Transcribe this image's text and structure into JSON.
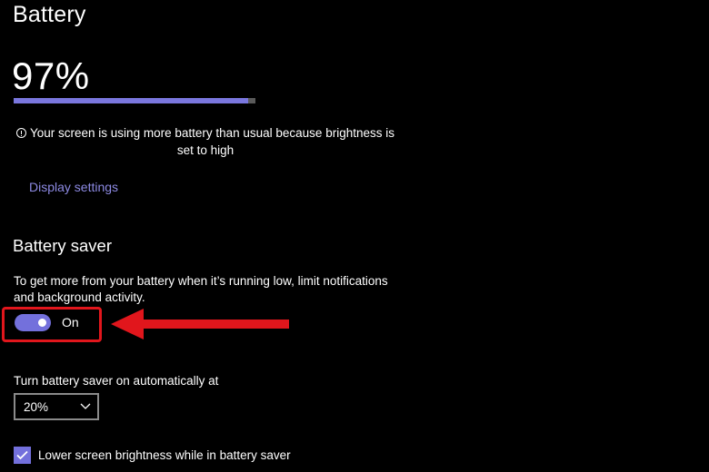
{
  "page": {
    "title": "Battery"
  },
  "battery": {
    "percent_text": "97%",
    "level": 0.97,
    "fill_color": "#7a77de",
    "warning_line1": "Your screen is using more battery than usual because brightness is",
    "warning_line2": "set to high",
    "warning_icon": "info-icon",
    "display_settings_link": "Display settings"
  },
  "battery_saver": {
    "heading": "Battery saver",
    "description_line1": "To get more from your battery when it’s running low, limit notifications",
    "description_line2": "and background activity.",
    "toggle_state": "On",
    "toggle_color": "#7370dc",
    "highlight_color": "#e1161c",
    "auto_label": "Turn battery saver on automatically at",
    "auto_value": "20%",
    "lower_brightness_label": "Lower screen brightness while in battery saver",
    "lower_brightness_checked": true
  }
}
